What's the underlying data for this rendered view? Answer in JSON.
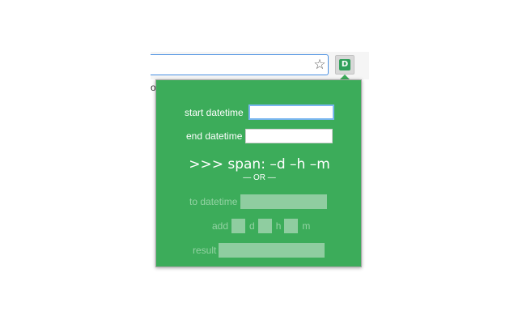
{
  "browser": {
    "star_icon": "star-icon",
    "extension_icon_letter": "D",
    "bookmark_fragment": "o"
  },
  "popup": {
    "start_label": "start datetime",
    "start_value": "",
    "end_label": "end datetime",
    "end_value": "",
    "span_text": ">>> span: –d –h –m",
    "or_text": "— OR —",
    "to_label": "to datetime",
    "to_value": "",
    "add_label": "add",
    "unit_d": "d",
    "unit_h": "h",
    "unit_m": "m",
    "result_label": "result",
    "result_value": ""
  },
  "colors": {
    "popup_bg": "#3cac5a",
    "disabled_field": "#8fcda0",
    "focus_border": "#7ab6f0"
  }
}
